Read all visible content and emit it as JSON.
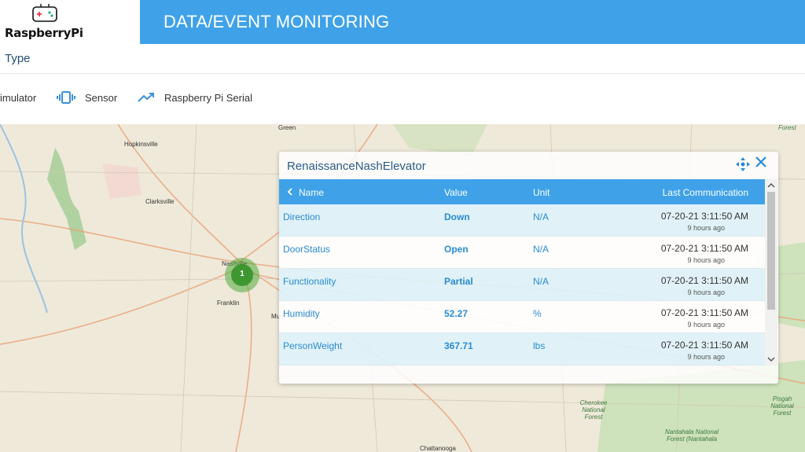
{
  "app": {
    "logo_text": "RaspberryPi",
    "header_title": "DATA/EVENT MONITORING",
    "type_label": "Type"
  },
  "tabs": [
    {
      "label": "imulator",
      "icon": "simulator-icon"
    },
    {
      "label": "Sensor",
      "icon": "vibration-sensor-icon"
    },
    {
      "label": "Raspberry Pi Serial",
      "icon": "trending-up-icon"
    }
  ],
  "map": {
    "labels": [
      "Green",
      "Hopkinsville",
      "Clarksville",
      "Nashville",
      "Franklin",
      "Murfreesboro",
      "Forest",
      "Cherokee National Forest",
      "Pisgah National Forest",
      "Nantahala National Forest (Nantahala",
      "Chattanooga"
    ],
    "cluster_count": "1"
  },
  "panel": {
    "title": "RenaissanceNashElevator",
    "columns": {
      "name": "Name",
      "value": "Value",
      "unit": "Unit",
      "last": "Last Communication"
    },
    "rows": [
      {
        "name": "Direction",
        "value": "Down",
        "unit": "N/A",
        "timestamp": "07-20-21 3:11:50 AM",
        "ago": "9 hours ago"
      },
      {
        "name": "DoorStatus",
        "value": "Open",
        "unit": "N/A",
        "timestamp": "07-20-21 3:11:50 AM",
        "ago": "9 hours ago"
      },
      {
        "name": "Functionality",
        "value": "Partial",
        "unit": "N/A",
        "timestamp": "07-20-21 3:11:50 AM",
        "ago": "9 hours ago"
      },
      {
        "name": "Humidity",
        "value": "52.27",
        "unit": "%",
        "timestamp": "07-20-21 3:11:50 AM",
        "ago": "9 hours ago"
      },
      {
        "name": "PersonWeight",
        "value": "367.71",
        "unit": "lbs",
        "timestamp": "07-20-21 3:11:50 AM",
        "ago": "9 hours ago"
      }
    ]
  },
  "colors": {
    "header": "#3fa2e9",
    "link": "#2a8ad4",
    "title": "#2a5b86"
  }
}
